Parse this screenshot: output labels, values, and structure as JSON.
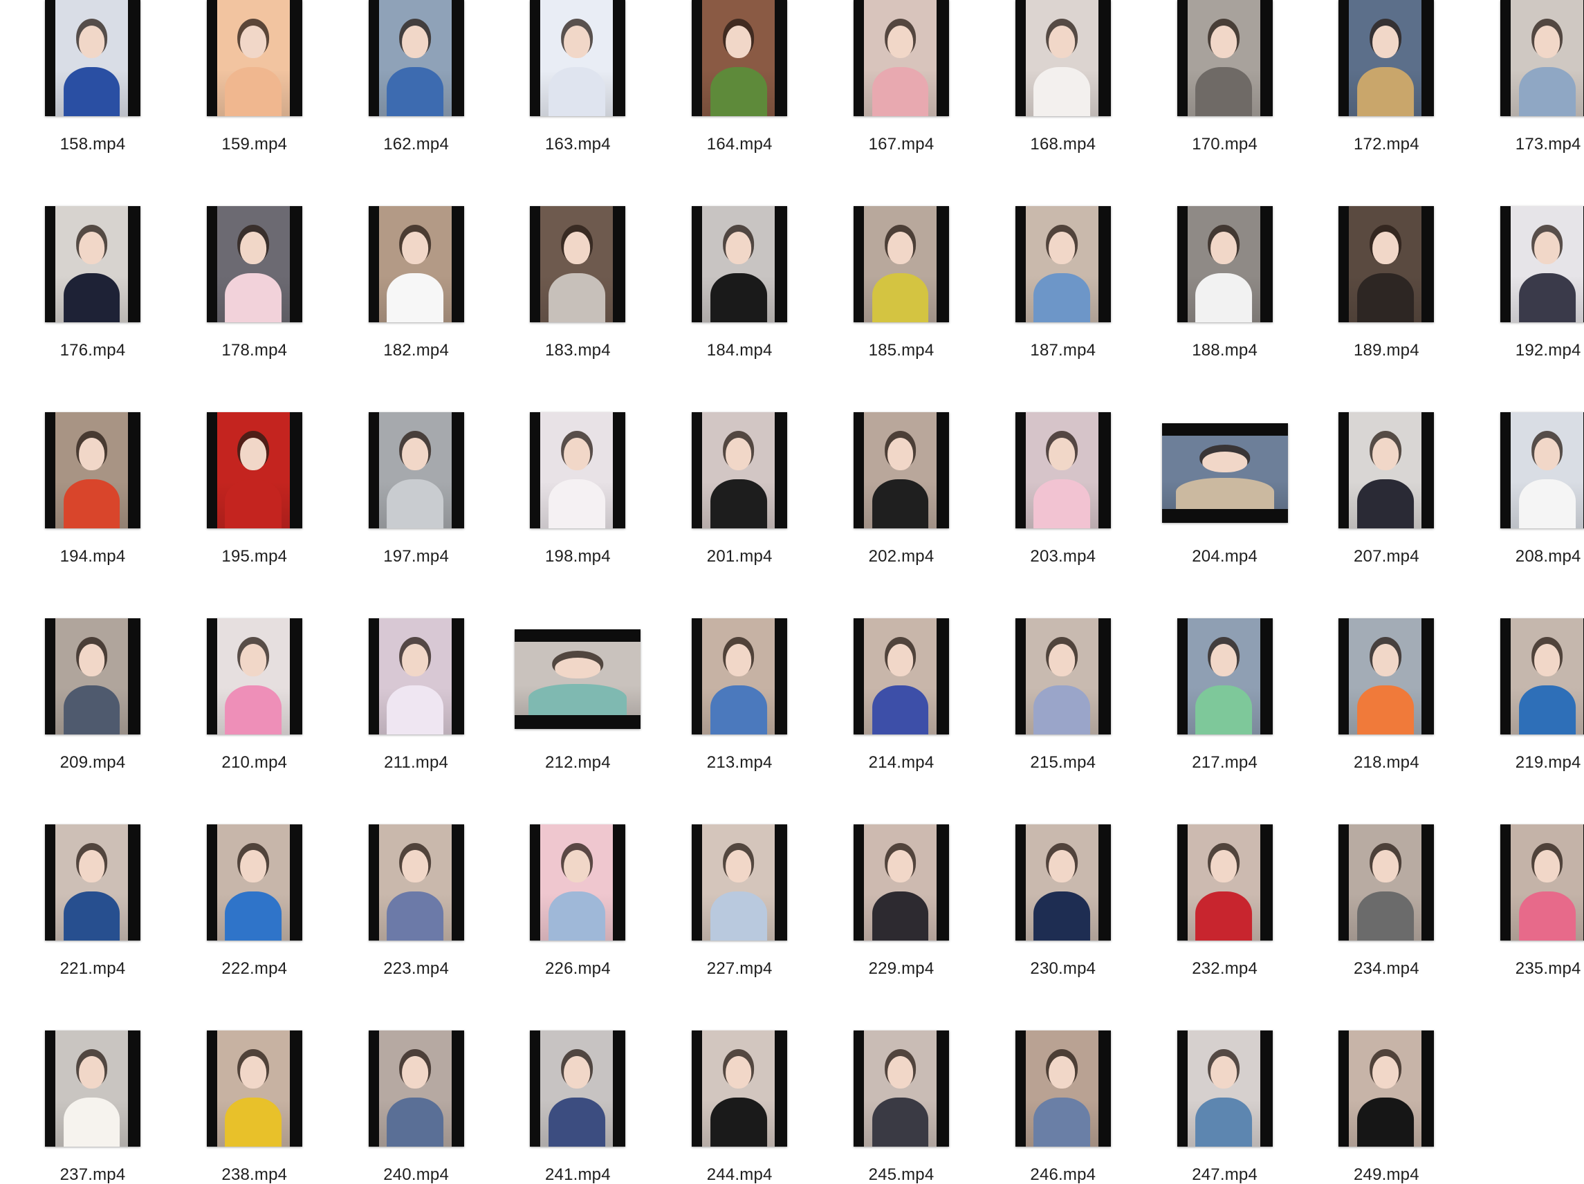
{
  "files": [
    {
      "name": "158.mp4",
      "icon": "video-thumbnail",
      "shape": "portrait",
      "bg": "#d9dde6",
      "clothing": "#2a4fa3"
    },
    {
      "name": "159.mp4",
      "icon": "video-thumbnail",
      "shape": "portrait",
      "bg": "#f2c4a0",
      "clothing": "#f0b78f"
    },
    {
      "name": "162.mp4",
      "icon": "video-thumbnail",
      "shape": "portrait",
      "bg": "#8fa2b8",
      "clothing": "#3d6bb0"
    },
    {
      "name": "163.mp4",
      "icon": "video-thumbnail",
      "shape": "portrait",
      "bg": "#e9edf5",
      "clothing": "#dfe4ef"
    },
    {
      "name": "164.mp4",
      "icon": "video-thumbnail",
      "shape": "portrait",
      "bg": "#8a5a44",
      "clothing": "#5e8a3a"
    },
    {
      "name": "167.mp4",
      "icon": "video-thumbnail",
      "shape": "portrait",
      "bg": "#d8c4bc",
      "clothing": "#e8a9b0"
    },
    {
      "name": "168.mp4",
      "icon": "video-thumbnail",
      "shape": "portrait",
      "bg": "#dcd4d0",
      "clothing": "#f3f0ee"
    },
    {
      "name": "170.mp4",
      "icon": "video-thumbnail",
      "shape": "portrait",
      "bg": "#a8a29c",
      "clothing": "#6f6a66"
    },
    {
      "name": "172.mp4",
      "icon": "video-thumbnail",
      "shape": "portrait",
      "bg": "#5c6f8a",
      "clothing": "#c9a66b"
    },
    {
      "name": "173.mp4",
      "icon": "video-thumbnail",
      "shape": "portrait",
      "bg": "#cfc8c2",
      "clothing": "#8fa7c4"
    },
    {
      "name": "176.mp4",
      "icon": "video-thumbnail",
      "shape": "portrait",
      "bg": "#d7d3cf",
      "clothing": "#1e2236"
    },
    {
      "name": "178.mp4",
      "icon": "video-thumbnail",
      "shape": "portrait",
      "bg": "#6c6a72",
      "clothing": "#f2d2da"
    },
    {
      "name": "182.mp4",
      "icon": "video-thumbnail",
      "shape": "portrait",
      "bg": "#b39a86",
      "clothing": "#f7f7f7"
    },
    {
      "name": "183.mp4",
      "icon": "video-thumbnail",
      "shape": "portrait",
      "bg": "#6e5a4e",
      "clothing": "#c7c0ba"
    },
    {
      "name": "184.mp4",
      "icon": "video-thumbnail",
      "shape": "portrait",
      "bg": "#c8c4c2",
      "clothing": "#1a1a1a"
    },
    {
      "name": "185.mp4",
      "icon": "video-thumbnail",
      "shape": "portrait",
      "bg": "#b8a89c",
      "clothing": "#d4c441"
    },
    {
      "name": "187.mp4",
      "icon": "video-thumbnail",
      "shape": "portrait",
      "bg": "#c9b9ac",
      "clothing": "#6d96c8"
    },
    {
      "name": "188.mp4",
      "icon": "video-thumbnail",
      "shape": "portrait",
      "bg": "#8f8a86",
      "clothing": "#f2f2f2"
    },
    {
      "name": "189.mp4",
      "icon": "video-thumbnail",
      "shape": "portrait",
      "bg": "#5a4a40",
      "clothing": "#2d2623"
    },
    {
      "name": "192.mp4",
      "icon": "video-thumbnail",
      "shape": "portrait",
      "bg": "#e6e4e8",
      "clothing": "#3a3a4a"
    },
    {
      "name": "194.mp4",
      "icon": "video-thumbnail",
      "shape": "portrait",
      "bg": "#a89484",
      "clothing": "#d9452b"
    },
    {
      "name": "195.mp4",
      "icon": "video-thumbnail",
      "shape": "portrait",
      "bg": "#c4241f",
      "clothing": "#c4241f"
    },
    {
      "name": "197.mp4",
      "icon": "video-thumbnail",
      "shape": "portrait",
      "bg": "#a6a9ad",
      "clothing": "#c9ccd0"
    },
    {
      "name": "198.mp4",
      "icon": "video-thumbnail",
      "shape": "portrait",
      "bg": "#e8e2e6",
      "clothing": "#f5f1f3"
    },
    {
      "name": "201.mp4",
      "icon": "video-thumbnail",
      "shape": "portrait",
      "bg": "#d2c6c4",
      "clothing": "#1d1d1d"
    },
    {
      "name": "202.mp4",
      "icon": "video-thumbnail",
      "shape": "portrait",
      "bg": "#b9a79b",
      "clothing": "#1f1f1f"
    },
    {
      "name": "203.mp4",
      "icon": "video-thumbnail",
      "shape": "portrait",
      "bg": "#d6c4c9",
      "clothing": "#f2c3d2"
    },
    {
      "name": "204.mp4",
      "icon": "video-thumbnail",
      "shape": "landscape",
      "bg": "#6d7f99",
      "clothing": "#cbb9a0"
    },
    {
      "name": "207.mp4",
      "icon": "video-thumbnail",
      "shape": "portrait",
      "bg": "#d9d6d4",
      "clothing": "#2a2a35"
    },
    {
      "name": "208.mp4",
      "icon": "video-thumbnail",
      "shape": "portrait",
      "bg": "#d9dde4",
      "clothing": "#f5f5f5"
    },
    {
      "name": "209.mp4",
      "icon": "video-thumbnail",
      "shape": "portrait",
      "bg": "#b0a59c",
      "clothing": "#4f5a6e"
    },
    {
      "name": "210.mp4",
      "icon": "video-thumbnail",
      "shape": "portrait",
      "bg": "#e6dfdf",
      "clothing": "#ee8fb8"
    },
    {
      "name": "211.mp4",
      "icon": "video-thumbnail",
      "shape": "portrait",
      "bg": "#d8c8d4",
      "clothing": "#efe6f2"
    },
    {
      "name": "212.mp4",
      "icon": "video-thumbnail",
      "shape": "landscape",
      "bg": "#c9c2bd",
      "clothing": "#7fb9b1"
    },
    {
      "name": "213.mp4",
      "icon": "video-thumbnail",
      "shape": "portrait",
      "bg": "#c6b2a4",
      "clothing": "#4b79bd"
    },
    {
      "name": "214.mp4",
      "icon": "video-thumbnail",
      "shape": "portrait",
      "bg": "#c8b6aa",
      "clothing": "#3d4fa8"
    },
    {
      "name": "215.mp4",
      "icon": "video-thumbnail",
      "shape": "portrait",
      "bg": "#c8bab0",
      "clothing": "#9aa5c9"
    },
    {
      "name": "217.mp4",
      "icon": "video-thumbnail",
      "shape": "portrait",
      "bg": "#8f9fb3",
      "clothing": "#7ec89a"
    },
    {
      "name": "218.mp4",
      "icon": "video-thumbnail",
      "shape": "portrait",
      "bg": "#a3acb6",
      "clothing": "#f07a3a"
    },
    {
      "name": "219.mp4",
      "icon": "video-thumbnail",
      "shape": "portrait",
      "bg": "#c5b7ad",
      "clothing": "#2e6fb8"
    },
    {
      "name": "221.mp4",
      "icon": "video-thumbnail",
      "shape": "portrait",
      "bg": "#cdbfb6",
      "clothing": "#274f8f"
    },
    {
      "name": "222.mp4",
      "icon": "video-thumbnail",
      "shape": "portrait",
      "bg": "#c7b6aa",
      "clothing": "#2f74c9"
    },
    {
      "name": "223.mp4",
      "icon": "video-thumbnail",
      "shape": "portrait",
      "bg": "#c9b8ac",
      "clothing": "#6c7aa8"
    },
    {
      "name": "226.mp4",
      "icon": "video-thumbnail",
      "shape": "portrait",
      "bg": "#efc7cf",
      "clothing": "#9fb8d8"
    },
    {
      "name": "227.mp4",
      "icon": "video-thumbnail",
      "shape": "portrait",
      "bg": "#d4c5bb",
      "clothing": "#b9c9de"
    },
    {
      "name": "229.mp4",
      "icon": "video-thumbnail",
      "shape": "portrait",
      "bg": "#cdbab0",
      "clothing": "#2d2a30"
    },
    {
      "name": "230.mp4",
      "icon": "video-thumbnail",
      "shape": "portrait",
      "bg": "#c9b9ae",
      "clothing": "#1e2d52"
    },
    {
      "name": "232.mp4",
      "icon": "video-thumbnail",
      "shape": "portrait",
      "bg": "#ccbab0",
      "clothing": "#c8252e"
    },
    {
      "name": "234.mp4",
      "icon": "video-thumbnail",
      "shape": "portrait",
      "bg": "#b8aba2",
      "clothing": "#6b6b6b"
    },
    {
      "name": "235.mp4",
      "icon": "video-thumbnail",
      "shape": "portrait",
      "bg": "#c4b3a8",
      "clothing": "#e76a8a"
    },
    {
      "name": "237.mp4",
      "icon": "video-thumbnail",
      "shape": "portrait",
      "bg": "#c9c5c1",
      "clothing": "#f6f3ee"
    },
    {
      "name": "238.mp4",
      "icon": "video-thumbnail",
      "shape": "portrait",
      "bg": "#c7b2a2",
      "clothing": "#e8c12a"
    },
    {
      "name": "240.mp4",
      "icon": "video-thumbnail",
      "shape": "portrait",
      "bg": "#b6a9a2",
      "clothing": "#5a6f96"
    },
    {
      "name": "241.mp4",
      "icon": "video-thumbnail",
      "shape": "portrait",
      "bg": "#c7c3c2",
      "clothing": "#3c4d80"
    },
    {
      "name": "244.mp4",
      "icon": "video-thumbnail",
      "shape": "portrait",
      "bg": "#d2c6bf",
      "clothing": "#1a1a1a"
    },
    {
      "name": "245.mp4",
      "icon": "video-thumbnail",
      "shape": "portrait",
      "bg": "#c9bcb5",
      "clothing": "#3a3a44"
    },
    {
      "name": "246.mp4",
      "icon": "video-thumbnail",
      "shape": "portrait",
      "bg": "#b9a293",
      "clothing": "#6a7fa6"
    },
    {
      "name": "247.mp4",
      "icon": "video-thumbnail",
      "shape": "portrait",
      "bg": "#d6d0ce",
      "clothing": "#5d86b0"
    },
    {
      "name": "249.mp4",
      "icon": "video-thumbnail",
      "shape": "portrait",
      "bg": "#c7b4a8",
      "clothing": "#161616"
    }
  ]
}
